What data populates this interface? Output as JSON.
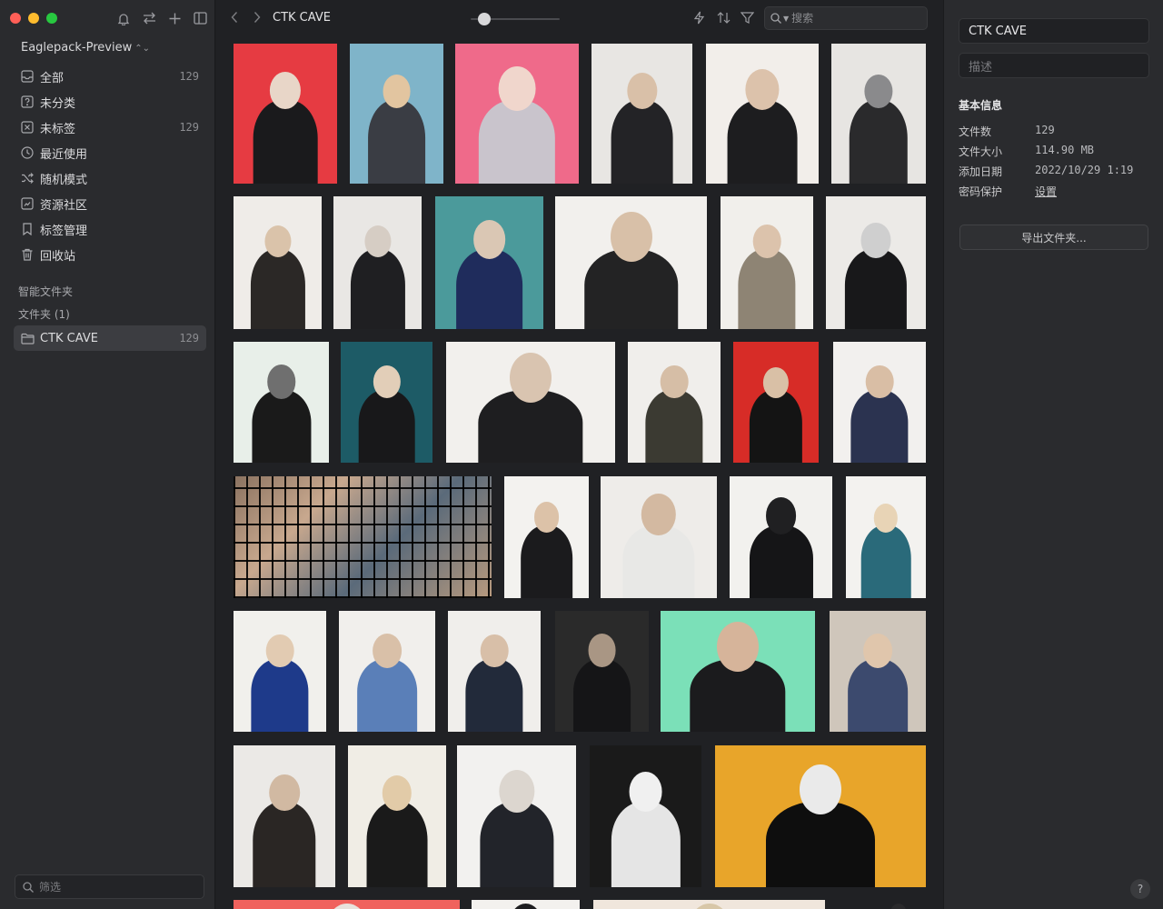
{
  "window": {
    "traffic_colors": [
      "#ff5f57",
      "#febc2e",
      "#28c840"
    ]
  },
  "sidebar": {
    "top_icons": [
      "bell-icon",
      "swap-icon",
      "plus-icon",
      "sidebar-toggle-icon"
    ],
    "library_name": "Eaglepack-Preview",
    "items": [
      {
        "label": "全部",
        "count": "129",
        "icon": "inbox-icon"
      },
      {
        "label": "未分类",
        "count": "",
        "icon": "question-box-icon"
      },
      {
        "label": "未标签",
        "count": "129",
        "icon": "tag-off-icon"
      },
      {
        "label": "最近使用",
        "count": "",
        "icon": "clock-icon"
      },
      {
        "label": "随机模式",
        "count": "",
        "icon": "shuffle-icon"
      },
      {
        "label": "资源社区",
        "count": "",
        "icon": "community-icon"
      },
      {
        "label": "标签管理",
        "count": "",
        "icon": "bookmark-icon"
      },
      {
        "label": "回收站",
        "count": "",
        "icon": "trash-icon"
      }
    ],
    "smart_folders_title": "智能文件夹",
    "folders_title": "文件夹 (1)",
    "folders": [
      {
        "label": "CTK CAVE",
        "count": "129",
        "icon": "folder-icon"
      }
    ],
    "filter_placeholder": "筛选"
  },
  "toolbar": {
    "breadcrumb": "CTK CAVE",
    "zoom_level": 0.1,
    "icons": [
      "lightning-icon",
      "sort-icon",
      "filter-icon"
    ],
    "search_placeholder": "搜索"
  },
  "inspector": {
    "title": "CTK CAVE",
    "description_placeholder": "描述",
    "basic_info_title": "基本信息",
    "info": [
      {
        "key": "文件数",
        "value": "129"
      },
      {
        "key": "文件大小",
        "value": "114.90 MB"
      },
      {
        "key": "添加日期",
        "value": "2022/10/29 1:19"
      },
      {
        "key": "密码保护",
        "value": "设置",
        "link": true
      }
    ],
    "export_label": "导出文件夹...",
    "help_label": "?"
  }
}
